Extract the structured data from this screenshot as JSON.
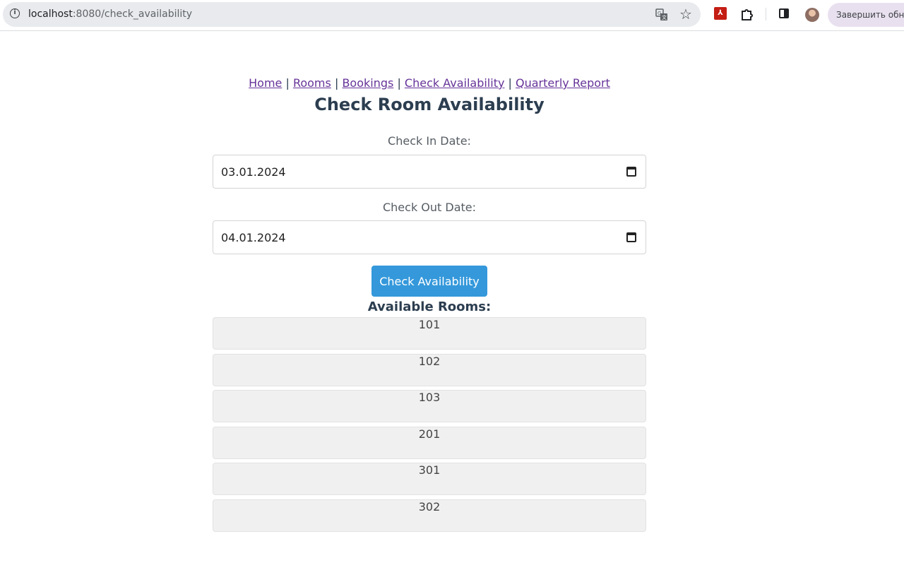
{
  "browser": {
    "url_host": "localhost",
    "url_path": ":8080/check_availability",
    "update_button_label": "Завершить обнов"
  },
  "nav": {
    "separator": "|",
    "links": [
      "Home",
      "Rooms",
      "Bookings",
      "Check Availability",
      "Quarterly Report"
    ]
  },
  "page": {
    "title": "Check Room Availability"
  },
  "form": {
    "check_in_label": "Check In Date:",
    "check_in_value": "03.01.2024",
    "check_out_label": "Check Out Date:",
    "check_out_value": "04.01.2024",
    "submit_label": "Check Availability"
  },
  "results": {
    "title": "Available Rooms:",
    "rooms": [
      "101",
      "102",
      "103",
      "201",
      "301",
      "302"
    ]
  },
  "colors": {
    "accent": "#3498db",
    "heading": "#2c3e50",
    "link": "#663399",
    "room_bg": "#f0f0f0"
  }
}
